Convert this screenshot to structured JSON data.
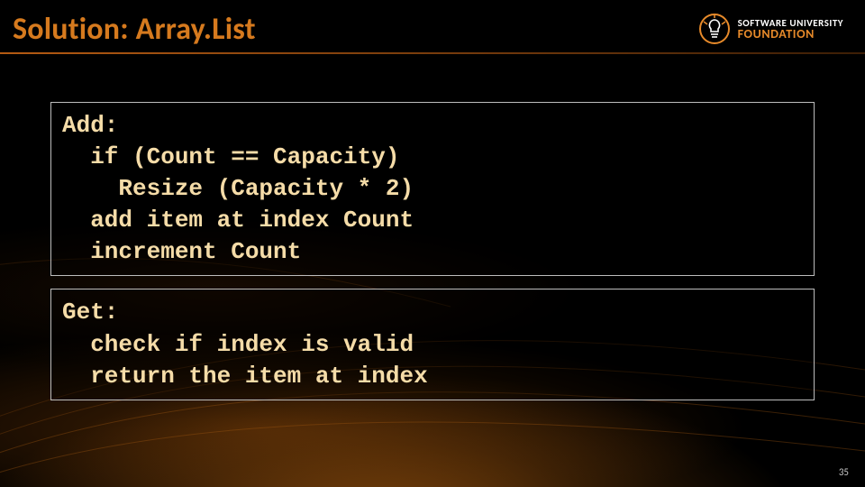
{
  "title": "Solution: Array.List",
  "logo": {
    "line1": "SOFTWARE UNIVERSITY",
    "line2": "FOUNDATION"
  },
  "code": {
    "add": "Add:\n  if (Count == Capacity)\n    Resize (Capacity * 2)\n  add item at index Count\n  increment Count",
    "get": "Get:\n  check if index is valid\n  return the item at index"
  },
  "pageNumber": "35"
}
